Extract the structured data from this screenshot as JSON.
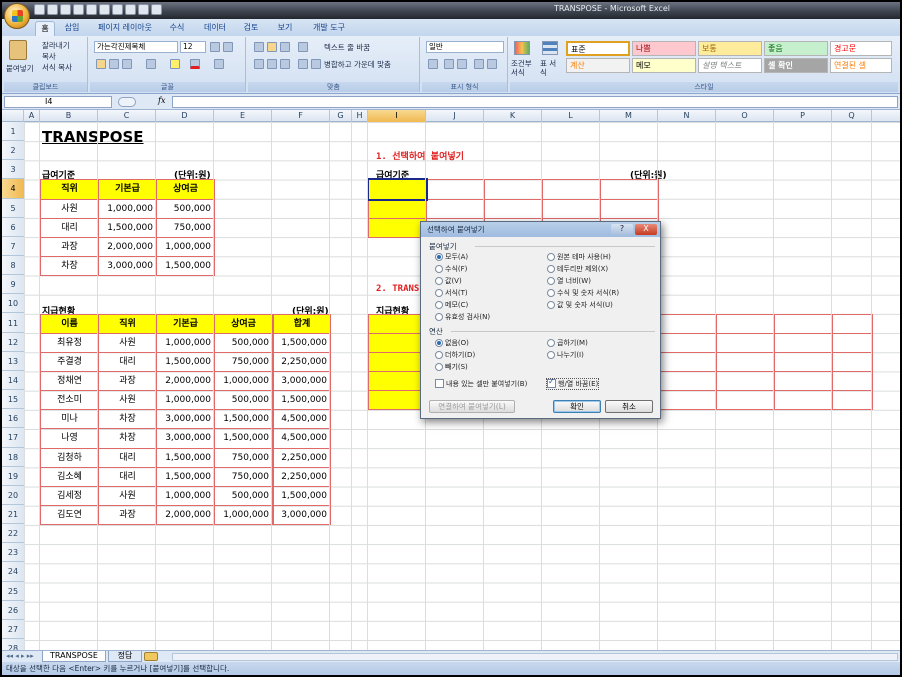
{
  "window": {
    "title": "TRANSPOSE - Microsoft Excel"
  },
  "ribbon": {
    "tabs": [
      "홈",
      "삽입",
      "페이지 레이아웃",
      "수식",
      "데이터",
      "검토",
      "보기",
      "개발 도구"
    ],
    "clipboard": {
      "paste": "붙여넣기",
      "cut": "잘라내기",
      "copy": "복사",
      "format_painter": "서식 복사",
      "label": "클립보드"
    },
    "font": {
      "name": "가는각진제목체",
      "size": "12",
      "label": "글꼴"
    },
    "alignment": {
      "wrap": "텍스트 줄 바꿈",
      "merge": "병합하고 가운데 맞춤",
      "label": "맞춤"
    },
    "number": {
      "format": "일반",
      "label": "표시 형식"
    },
    "styles": {
      "conditional": "조건부 서식",
      "table": "표 서식",
      "label": "스타일",
      "cells": [
        {
          "label": "표준",
          "bg": "#ffffff",
          "color": "#000000"
        },
        {
          "label": "나쁨",
          "bg": "#ffc7ce",
          "color": "#9c0006"
        },
        {
          "label": "보통",
          "bg": "#ffeb9c",
          "color": "#9c6500"
        },
        {
          "label": "좋음",
          "bg": "#c6efce",
          "color": "#006100"
        },
        {
          "label": "경고문",
          "bg": "#ffffff",
          "color": "#ff0000"
        },
        {
          "label": "계산",
          "bg": "#f2f2f2",
          "color": "#fa7d00"
        },
        {
          "label": "메모",
          "bg": "#ffffcc",
          "color": "#000000"
        },
        {
          "label": "설명 텍스트",
          "bg": "#ffffff",
          "color": "#7f7f7f"
        },
        {
          "label": "셀 확인",
          "bg": "#a5a5a5",
          "color": "#ffffff"
        },
        {
          "label": "연결된 셀",
          "bg": "#ffffff",
          "color": "#fa7d00"
        }
      ]
    }
  },
  "formula_bar": {
    "cell_ref": "I4",
    "fx": "fx",
    "value": ""
  },
  "columns": [
    "A",
    "B",
    "C",
    "D",
    "E",
    "F",
    "G",
    "H",
    "I",
    "J",
    "K",
    "L",
    "M",
    "N",
    "O",
    "P",
    "Q"
  ],
  "rows": [
    "1",
    "2",
    "3",
    "4",
    "5",
    "6",
    "7",
    "8",
    "9",
    "10",
    "11",
    "12",
    "13",
    "14",
    "15",
    "16",
    "17",
    "18",
    "19",
    "20",
    "21",
    "22",
    "23",
    "24",
    "25",
    "26",
    "27",
    "28"
  ],
  "sheet": {
    "title": "TRANSPOSE",
    "table1": {
      "caption": "급여기준",
      "unit": "(단위:원)",
      "headers": [
        "직위",
        "기본급",
        "상여금"
      ],
      "rows": [
        [
          "사원",
          "1,000,000",
          "500,000"
        ],
        [
          "대리",
          "1,500,000",
          "750,000"
        ],
        [
          "과장",
          "2,000,000",
          "1,000,000"
        ],
        [
          "차장",
          "3,000,000",
          "1,500,000"
        ]
      ]
    },
    "table2": {
      "caption": "지급현황",
      "unit": "(단위:원)",
      "headers": [
        "이름",
        "직위",
        "기본급",
        "상여금",
        "합계"
      ],
      "rows": [
        [
          "최유정",
          "사원",
          "1,000,000",
          "500,000",
          "1,500,000"
        ],
        [
          "주결경",
          "대리",
          "1,500,000",
          "750,000",
          "2,250,000"
        ],
        [
          "정채연",
          "과장",
          "2,000,000",
          "1,000,000",
          "3,000,000"
        ],
        [
          "전소미",
          "사원",
          "1,000,000",
          "500,000",
          "1,500,000"
        ],
        [
          "미나",
          "차장",
          "3,000,000",
          "1,500,000",
          "4,500,000"
        ],
        [
          "나영",
          "차장",
          "3,000,000",
          "1,500,000",
          "4,500,000"
        ],
        [
          "김청하",
          "대리",
          "1,500,000",
          "750,000",
          "2,250,000"
        ],
        [
          "김소혜",
          "대리",
          "1,500,000",
          "750,000",
          "2,250,000"
        ],
        [
          "김세정",
          "사원",
          "1,000,000",
          "500,000",
          "1,500,000"
        ],
        [
          "김도연",
          "과장",
          "2,000,000",
          "1,000,000",
          "3,000,000"
        ]
      ]
    },
    "step1": "1. 선택하여 붙여넣기",
    "step2": "2. TRANSPOSE",
    "target1": {
      "caption": "급여기준",
      "unit": "(단위:원)"
    },
    "target2": {
      "caption": "지급현황"
    }
  },
  "dialog": {
    "title": "선택하여 붙여넣기",
    "paste_section": "붙여넣기",
    "paste_options": [
      "모두(A)",
      "원본 테마 사용(H)",
      "수식(F)",
      "테두리만 제외(X)",
      "값(V)",
      "열 너비(W)",
      "서식(T)",
      "수식 및 숫자 서식(R)",
      "메모(C)",
      "값 및 숫자 서식(U)",
      "유효성 검사(N)"
    ],
    "op_section": "연산",
    "op_options": [
      "없음(O)",
      "곱하기(M)",
      "더하기(D)",
      "나누기(I)",
      "빼기(S)"
    ],
    "skip_blanks": "내용 있는 셀만 붙여넣기(B)",
    "transpose": "행/열 바꿈(E)",
    "paste_link": "연결하여 붙여넣기(L)",
    "ok": "확인",
    "cancel": "취소",
    "help": "?",
    "close": "X"
  },
  "sheet_tabs": [
    "TRANSPOSE",
    "정답"
  ],
  "status": "대상을 선택한 다음 <Enter> 키를 누르거나 [붙여넣기]를 선택합니다."
}
